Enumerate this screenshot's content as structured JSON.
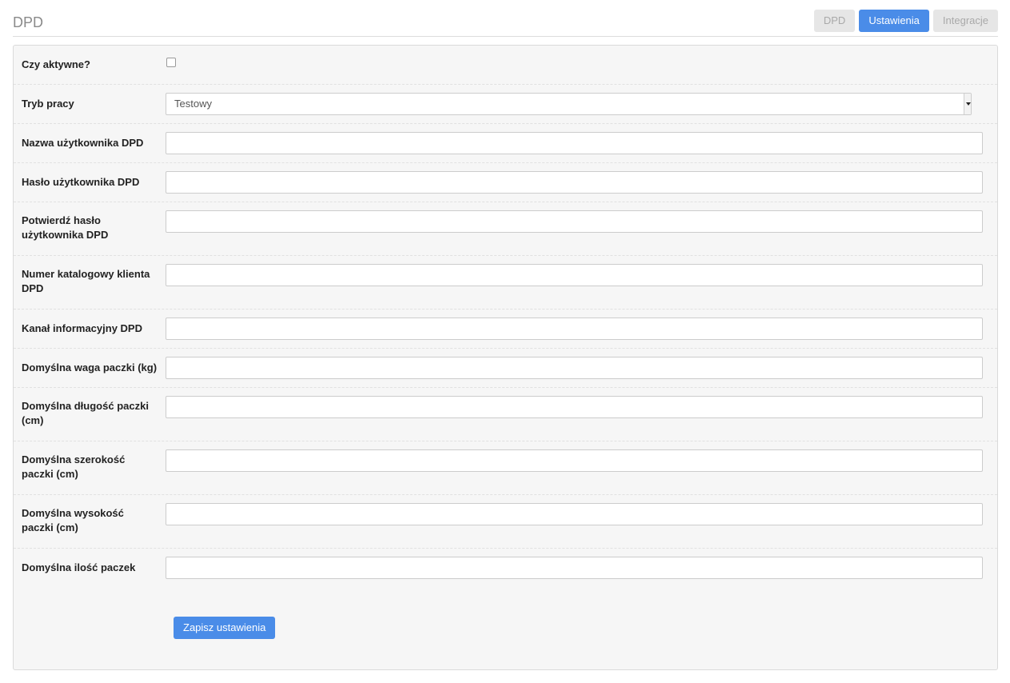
{
  "header": {
    "title": "DPD",
    "tabs": [
      {
        "label": "DPD",
        "active": false
      },
      {
        "label": "Ustawienia",
        "active": true
      },
      {
        "label": "Integracje",
        "active": false
      }
    ]
  },
  "form": {
    "active_label": "Czy aktywne?",
    "active_checked": false,
    "mode_label": "Tryb pracy",
    "mode_value": "Testowy",
    "fields": [
      {
        "label": "Nazwa użytkownika DPD",
        "value": ""
      },
      {
        "label": "Hasło użytkownika DPD",
        "value": ""
      },
      {
        "label": "Potwierdź hasło użytkownika DPD",
        "value": ""
      },
      {
        "label": "Numer katalogowy klienta DPD",
        "value": ""
      },
      {
        "label": "Kanał informacyjny DPD",
        "value": ""
      },
      {
        "label": "Domyślna waga paczki (kg)",
        "value": ""
      },
      {
        "label": "Domyślna długość paczki (cm)",
        "value": ""
      },
      {
        "label": "Domyślna szerokość paczki (cm)",
        "value": ""
      },
      {
        "label": "Domyślna wysokość paczki (cm)",
        "value": ""
      },
      {
        "label": "Domyślna ilość paczek",
        "value": ""
      }
    ],
    "save_label": "Zapisz ustawienia"
  },
  "colors": {
    "accent": "#4a8ce8",
    "tab_inactive": "#e6e6e6",
    "panel_bg": "#f6f6f6"
  }
}
